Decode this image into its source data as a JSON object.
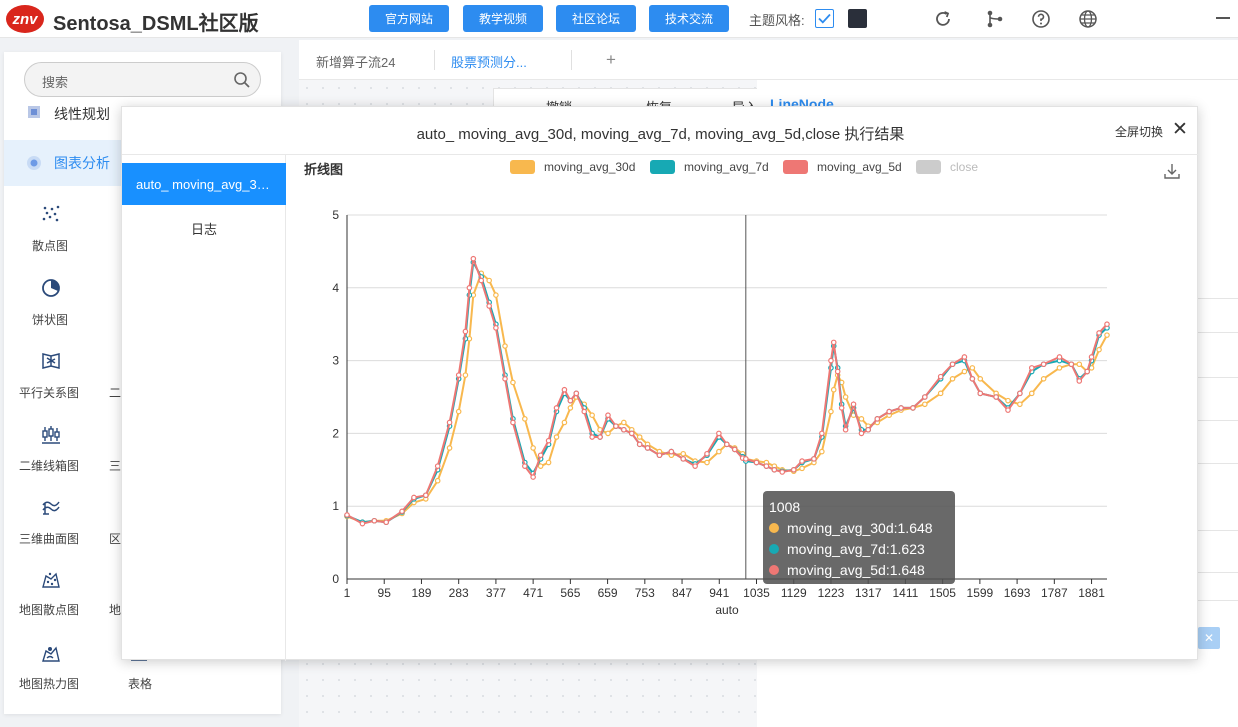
{
  "app": {
    "logo_text": "znv",
    "title": "Sentosa_DSML社区版"
  },
  "nav": {
    "buttons": [
      "官方网站",
      "教学视频",
      "社区论坛",
      "技术交流"
    ],
    "theme_label": "主题风格:"
  },
  "top_icons": [
    "refresh-icon",
    "branch-icon",
    "help-icon",
    "globe-icon",
    "minimize-icon"
  ],
  "sidebar": {
    "search_placeholder": "搜索",
    "categories": [
      "线性规划",
      "图表分析"
    ],
    "items": [
      {
        "label": "散点图",
        "icon": "scatter-icon"
      },
      {
        "label": "饼状图",
        "icon": "pie-icon"
      },
      {
        "label": "平行关系图",
        "icon": "parallel-icon"
      },
      {
        "label": "二维线箱图",
        "icon": "boxplot-icon"
      },
      {
        "label": "三维曲面图",
        "icon": "surface-icon"
      },
      {
        "label": "地图散点图",
        "icon": "map-scatter-icon"
      },
      {
        "label": "地图热力图",
        "icon": "map-heat-icon"
      },
      {
        "label": "表格",
        "icon": "table-icon"
      }
    ],
    "partial_labels": [
      "二",
      "三",
      "区",
      "地"
    ]
  },
  "tabs": [
    "新增算子流24",
    "股票预测分...",
    "+"
  ],
  "toolbar": {
    "undo": "撤销",
    "redo": "恢复",
    "import": "导入"
  },
  "right_panel": {
    "title_partial": "LineNode",
    "close": "✕"
  },
  "modal": {
    "title": "auto_ moving_avg_30d, moving_avg_7d, moving_avg_5d,close 执行结果",
    "fullscreen": "全屏切换",
    "close": "✕",
    "left_items": [
      "auto_ moving_avg_30d, moving_avg_7d, moving_avg_5d,close",
      "日志"
    ],
    "chart_label": "折线图"
  },
  "colors": {
    "primary": "#2d8cf0",
    "active": "#1890ff",
    "series_30d": "#f8b84e",
    "series_7d": "#17a9b4",
    "series_5d": "#ee7774",
    "series_close": "#cccccc"
  },
  "chart_data": {
    "type": "line",
    "xlabel": "auto",
    "ylabel": "",
    "ylim": [
      0,
      5
    ],
    "yticks": [
      0,
      1,
      2,
      3,
      4,
      5
    ],
    "xlim": [
      1,
      1920
    ],
    "xticks": [
      1,
      95,
      189,
      283,
      377,
      471,
      565,
      659,
      753,
      847,
      941,
      1035,
      1129,
      1223,
      1317,
      1411,
      1505,
      1599,
      1693,
      1787,
      1881
    ],
    "legend_position": "top",
    "grid": true,
    "x_points": [
      1,
      40,
      70,
      100,
      140,
      170,
      200,
      230,
      260,
      283,
      300,
      310,
      320,
      340,
      360,
      377,
      400,
      420,
      450,
      471,
      490,
      510,
      530,
      550,
      565,
      580,
      600,
      620,
      640,
      660,
      680,
      700,
      720,
      740,
      760,
      790,
      820,
      850,
      880,
      910,
      940,
      960,
      980,
      1000,
      1008,
      1035,
      1060,
      1080,
      1100,
      1129,
      1150,
      1180,
      1200,
      1223,
      1230,
      1240,
      1250,
      1260,
      1280,
      1300,
      1317,
      1340,
      1370,
      1400,
      1430,
      1460,
      1500,
      1530,
      1560,
      1580,
      1600,
      1640,
      1670,
      1700,
      1730,
      1760,
      1800,
      1830,
      1850,
      1870,
      1881,
      1900,
      1920
    ],
    "series": [
      {
        "name": "moving_avg_30d",
        "values": [
          0.86,
          0.78,
          0.8,
          0.8,
          0.9,
          1.05,
          1.1,
          1.35,
          1.8,
          2.3,
          2.8,
          3.3,
          3.9,
          4.2,
          4.1,
          3.9,
          3.2,
          2.7,
          2.2,
          1.8,
          1.55,
          1.6,
          1.95,
          2.15,
          2.35,
          2.5,
          2.4,
          2.25,
          2.05,
          2.0,
          2.1,
          2.15,
          2.05,
          1.95,
          1.85,
          1.75,
          1.7,
          1.72,
          1.62,
          1.6,
          1.75,
          1.85,
          1.8,
          1.72,
          1.65,
          1.62,
          1.6,
          1.55,
          1.5,
          1.48,
          1.52,
          1.6,
          1.75,
          2.3,
          2.6,
          2.8,
          2.7,
          2.5,
          2.25,
          2.2,
          2.1,
          2.15,
          2.25,
          2.32,
          2.35,
          2.4,
          2.55,
          2.75,
          2.85,
          2.9,
          2.75,
          2.55,
          2.45,
          2.4,
          2.55,
          2.75,
          2.9,
          2.95,
          2.95,
          2.85,
          2.9,
          3.15,
          3.35
        ]
      },
      {
        "name": "moving_avg_7d",
        "values": [
          0.87,
          0.78,
          0.8,
          0.78,
          0.92,
          1.1,
          1.15,
          1.5,
          2.1,
          2.75,
          3.3,
          3.9,
          4.35,
          4.15,
          3.8,
          3.5,
          2.8,
          2.2,
          1.6,
          1.45,
          1.65,
          1.85,
          2.3,
          2.55,
          2.45,
          2.55,
          2.35,
          2.0,
          1.95,
          2.2,
          2.1,
          2.05,
          2.0,
          1.85,
          1.8,
          1.7,
          1.75,
          1.65,
          1.58,
          1.7,
          1.95,
          1.85,
          1.78,
          1.68,
          1.62,
          1.6,
          1.55,
          1.5,
          1.48,
          1.5,
          1.6,
          1.65,
          1.95,
          2.9,
          3.2,
          2.9,
          2.4,
          2.1,
          2.35,
          2.05,
          2.05,
          2.2,
          2.3,
          2.35,
          2.35,
          2.5,
          2.75,
          2.95,
          3.0,
          2.75,
          2.55,
          2.5,
          2.35,
          2.55,
          2.85,
          2.95,
          3.0,
          2.95,
          2.75,
          2.85,
          3.0,
          3.35,
          3.45
        ]
      },
      {
        "name": "moving_avg_5d",
        "values": [
          0.88,
          0.76,
          0.8,
          0.78,
          0.93,
          1.12,
          1.15,
          1.55,
          2.15,
          2.8,
          3.4,
          4.0,
          4.4,
          4.1,
          3.75,
          3.45,
          2.75,
          2.15,
          1.55,
          1.4,
          1.7,
          1.9,
          2.35,
          2.6,
          2.45,
          2.55,
          2.3,
          1.95,
          1.95,
          2.25,
          2.1,
          2.05,
          2.0,
          1.85,
          1.8,
          1.7,
          1.75,
          1.65,
          1.55,
          1.72,
          2.0,
          1.85,
          1.78,
          1.66,
          1.65,
          1.6,
          1.55,
          1.5,
          1.47,
          1.5,
          1.62,
          1.65,
          2.0,
          3.0,
          3.25,
          2.85,
          2.35,
          2.05,
          2.4,
          2.0,
          2.05,
          2.2,
          2.3,
          2.35,
          2.35,
          2.5,
          2.78,
          2.95,
          3.05,
          2.75,
          2.55,
          2.5,
          2.32,
          2.55,
          2.9,
          2.95,
          3.05,
          2.95,
          2.72,
          2.85,
          3.05,
          3.38,
          3.5
        ]
      },
      {
        "name": "close",
        "values": []
      }
    ],
    "crosshair_x": 1008,
    "tooltip": {
      "title": "1008",
      "rows": [
        {
          "name": "moving_avg_30d",
          "value": "1.648",
          "text": "moving_avg_30d:1.648"
        },
        {
          "name": "moving_avg_7d",
          "value": "1.623",
          "text": "moving_avg_7d:1.623"
        },
        {
          "name": "moving_avg_5d",
          "value": "1.648",
          "text": "moving_avg_5d:1.648"
        }
      ]
    }
  }
}
